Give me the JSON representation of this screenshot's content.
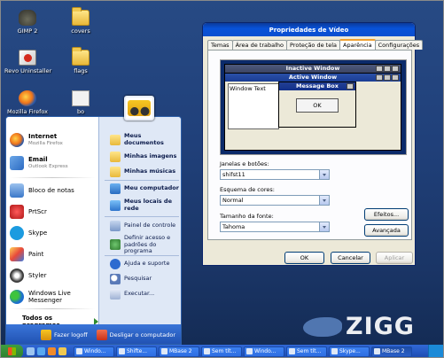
{
  "desktop": {
    "icons": [
      {
        "label": "GIMP 2",
        "icon": "gimp-icon"
      },
      {
        "label": "covers",
        "icon": "folder-icon"
      },
      {
        "label": "Revo Uninstaller",
        "icon": "revo-uninstaller-icon"
      },
      {
        "label": "flags",
        "icon": "folder-icon"
      },
      {
        "label": "Mozilla Firefox",
        "icon": "firefox-icon"
      },
      {
        "label": "bo",
        "icon": "document-icon"
      }
    ]
  },
  "start_menu": {
    "pinned": [
      {
        "title": "Internet",
        "subtitle": "Mozilla Firefox"
      },
      {
        "title": "Email",
        "subtitle": "Outlook Express"
      }
    ],
    "recent": [
      "Bloco de notas",
      "PrtScr",
      "Skype",
      "Paint",
      "Styler",
      "Windows Live Messenger"
    ],
    "all_programs": "Todos os programas",
    "right": [
      {
        "label": "Meus documentos",
        "bold": true
      },
      {
        "label": "Minhas imagens",
        "bold": true
      },
      {
        "label": "Minhas músicas",
        "bold": true
      },
      {
        "label": "Meu computador",
        "bold": true
      },
      {
        "label": "Meus locais de rede",
        "bold": true
      },
      {
        "label": "Painel de controle",
        "bold": false
      },
      {
        "label": "Definir acesso e padrões do programa",
        "bold": false
      },
      {
        "label": "Ajuda e suporte",
        "bold": false
      },
      {
        "label": "Pesquisar",
        "bold": false
      },
      {
        "label": "Executar...",
        "bold": false
      }
    ],
    "logoff": "Fazer logoff",
    "shutdown": "Desligar o computador"
  },
  "taskbar": {
    "tasks": [
      "Windo...",
      "Shifte...",
      "MBase 2",
      "Sem tít...",
      "Windo...",
      "Sem tít...",
      "Skype...",
      "MBase 2"
    ]
  },
  "dialog": {
    "title": "Propriedades de Vídeo",
    "tabs": [
      "Temas",
      "Área de trabalho",
      "Proteção de tela",
      "Aparência",
      "Configurações"
    ],
    "selected_tab": "Aparência",
    "preview": {
      "inactive_title": "Inactive Window",
      "active_title": "Active Window",
      "window_text": "Window Text",
      "msgbox_title": "Message Box",
      "msgbox_ok": "OK"
    },
    "windows_buttons_label": "Janelas e botões:",
    "windows_buttons_value": "shifst11",
    "color_scheme_label": "Esquema de cores:",
    "color_scheme_value": "Normal",
    "font_size_label": "Tamanho da fonte:",
    "font_size_value": "Tahoma",
    "effects_button": "Efeitos...",
    "advanced_button": "Avançada",
    "ok_button": "OK",
    "cancel_button": "Cancelar",
    "apply_button": "Aplicar"
  },
  "watermark": {
    "text": "ZIGG"
  },
  "colors": {
    "desktop": "#20407a",
    "taskbar": "#2457c1",
    "dialog_title": "#0852d8",
    "dialog_bg": "#ece9d8"
  }
}
